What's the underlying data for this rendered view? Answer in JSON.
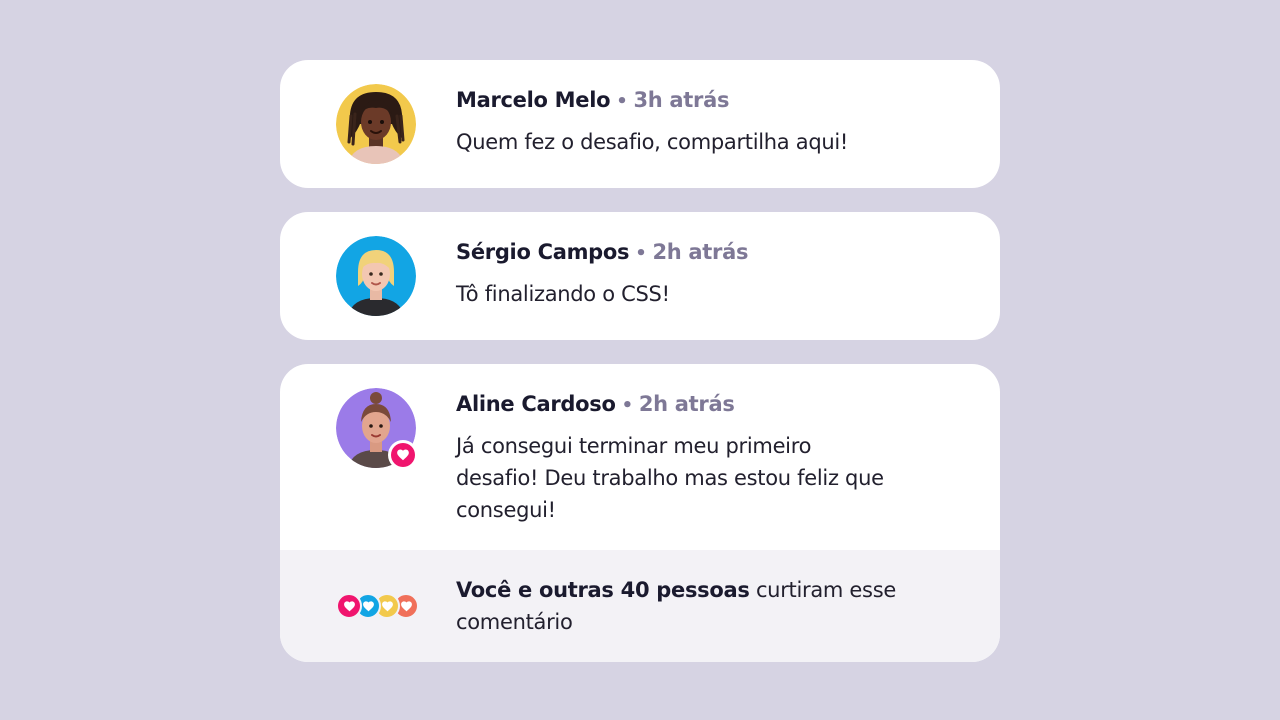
{
  "colors": {
    "background": "#D6D3E3",
    "card": "#FFFFFF",
    "footer": "#F3F2F6",
    "name": "#1A1A2E",
    "muted": "#7E7896",
    "like": "#F0156E"
  },
  "separator": "•",
  "comments": [
    {
      "name": "Marcelo Melo",
      "time": "3h atrás",
      "message": "Quem fez o desafio, compartilha aqui!",
      "avatar_bg": "#F2C94C"
    },
    {
      "name": "Sérgio Campos",
      "time": "2h atrás",
      "message": "Tô finalizando o CSS!",
      "avatar_bg": "#12A5E4"
    },
    {
      "name": "Aline Cardoso",
      "time": "2h atrás",
      "message_lines": [
        "Já consegui terminar meu primeiro",
        "desafio! Deu trabalho mas estou feliz que",
        "consegui!"
      ],
      "avatar_bg": "#9B7BE8",
      "liked": true
    }
  ],
  "likes": {
    "bold_text": "Você e outras 40 pessoas",
    "text_rest": " curtiram esse",
    "text_line2": "comentário",
    "reaction_icons": [
      "heart-icon",
      "heart-icon",
      "heart-icon",
      "heart-icon"
    ],
    "reaction_colors": [
      "#F0156E",
      "#12A5E4",
      "#F2C94C",
      "#F0705A"
    ]
  }
}
